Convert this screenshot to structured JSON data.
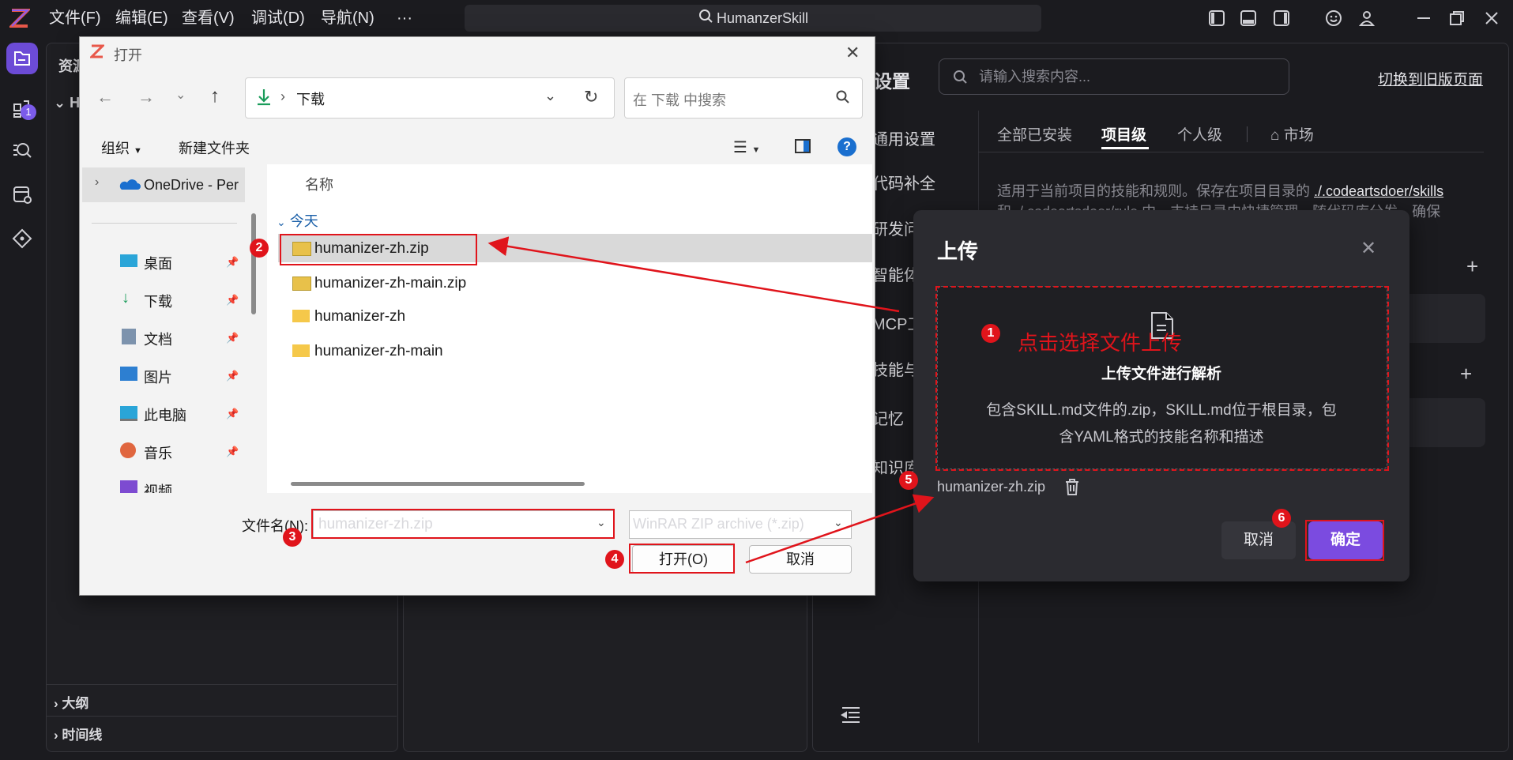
{
  "app": {
    "title": "HumanzerSkill",
    "menu": [
      "文件(F)",
      "编辑(E)",
      "查看(V)",
      "调试(D)",
      "导航(N)",
      "···"
    ]
  },
  "explorer": {
    "title": "资源",
    "root": "H",
    "outline": "大纲",
    "timeline": "时间线"
  },
  "settings": {
    "title": "设置",
    "search_placeholder": "请输入搜索内容...",
    "switch_link": "切换到旧版页面",
    "nav": [
      "通用设置",
      "代码补全",
      "研发问",
      "智能体",
      "MCP工",
      "技能与",
      "记忆",
      "知识库"
    ],
    "tabs": [
      "全部已安装",
      "项目级",
      "个人级",
      "市场"
    ],
    "desc_line1": "适用于当前项目的技能和规则。保存在项目目录的",
    "desc_path": "./.codeartsdoer/skills",
    "desc_line2": "和 ./.codeartsdoer/rule 中，支持目录中快捷管理，随代码库分发，确保"
  },
  "dialog": {
    "title": "打开",
    "breadcrumb": "下载",
    "search_placeholder": "在 下载 中搜索",
    "organize": "组织",
    "new_folder": "新建文件夹",
    "nav": {
      "onedrive": "OneDrive - Per",
      "quick_access": [
        "桌面",
        "下载",
        "文档",
        "图片",
        "此电脑",
        "音乐",
        "视频"
      ]
    },
    "col_name": "名称",
    "group_today": "今天",
    "files": [
      "humanizer-zh.zip",
      "humanizer-zh-main.zip",
      "humanizer-zh",
      "humanizer-zh-main"
    ],
    "filename_label": "文件名(N):",
    "filename_value": "humanizer-zh.zip",
    "filetype": "WinRAR ZIP archive (*.zip)",
    "open_btn": "打开(O)",
    "cancel_btn": "取消"
  },
  "upload": {
    "title": "上传",
    "drop_title": "上传文件进行解析",
    "drop_desc1": "包含SKILL.md文件的.zip，SKILL.md位于根目录，包",
    "drop_desc2": "含YAML格式的技能名称和描述",
    "uploaded_file": "humanizer-zh.zip",
    "cancel": "取消",
    "confirm": "确定"
  },
  "annotations": {
    "numbers": [
      "1",
      "2",
      "3",
      "4",
      "5",
      "6"
    ],
    "callout": "点击选择文件上传",
    "color": "#e0141b"
  },
  "colors": {
    "accent": "#7b4be0",
    "annotation": "#e0141b"
  }
}
